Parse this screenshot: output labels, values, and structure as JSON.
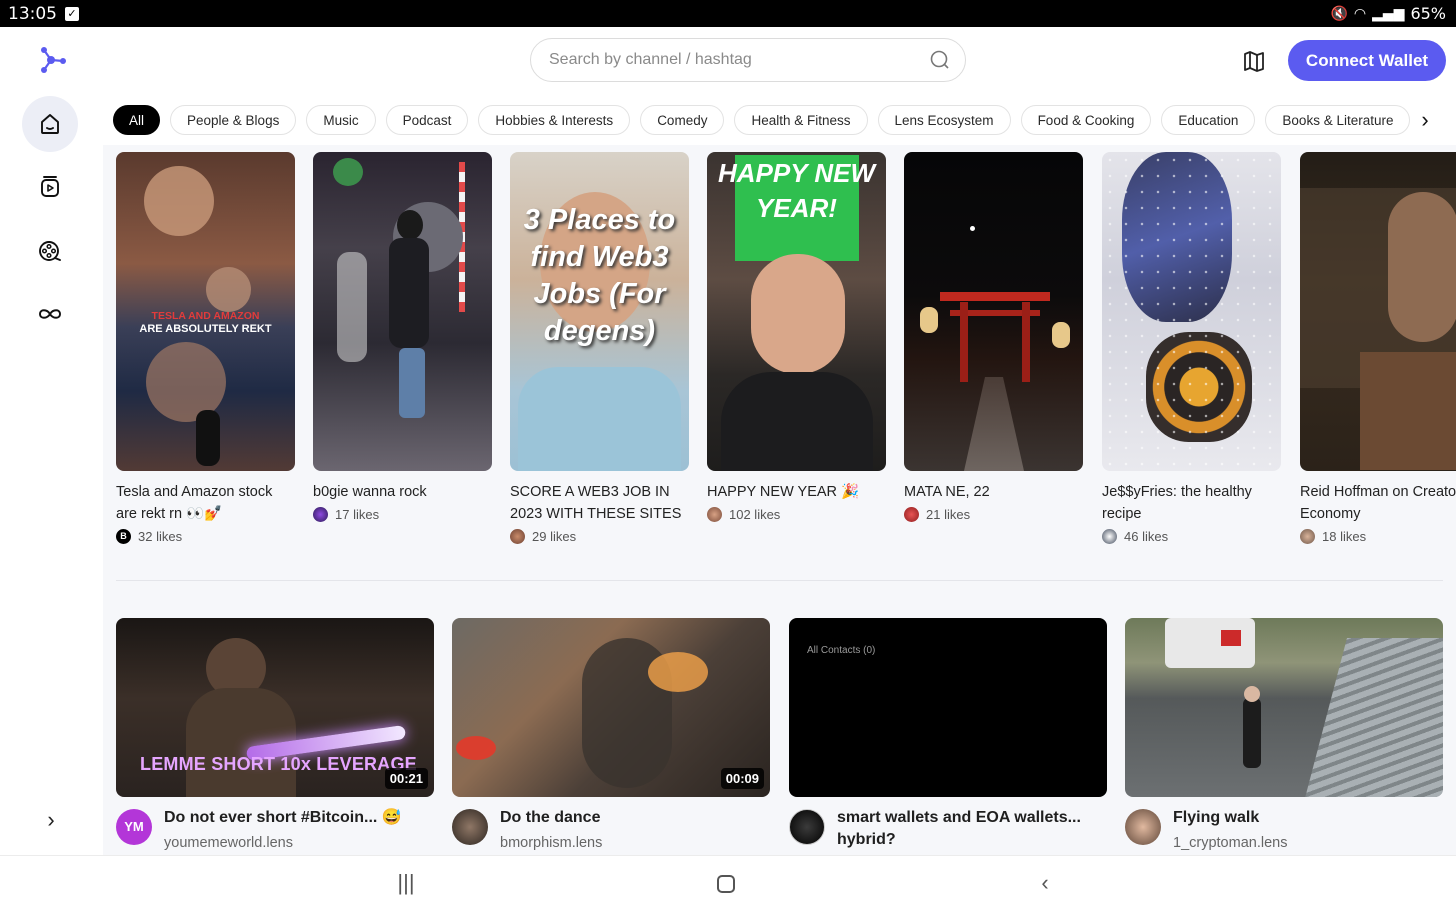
{
  "status_bar": {
    "time": "13:05",
    "battery": "65%"
  },
  "header": {
    "search_placeholder": "Search by channel / hashtag",
    "connect_label": "Connect Wallet",
    "accent_color": "#5b5bf0"
  },
  "categories": [
    "All",
    "People & Blogs",
    "Music",
    "Podcast",
    "Hobbies & Interests",
    "Comedy",
    "Health & Fitness",
    "Lens Ecosystem",
    "Food & Cooking",
    "Education",
    "Books & Literature"
  ],
  "shorts": [
    {
      "title": "Tesla and Amazon stock are rekt rn 👀💅",
      "likes": "32 likes",
      "overlay_line1": "TESLA AND AMAZON",
      "overlay_line2": "ARE ABSOLUTELY REKT"
    },
    {
      "title": "b0gie wanna rock",
      "likes": "17 likes"
    },
    {
      "title": "SCORE A WEB3 JOB IN 2023 WITH THESE SITES",
      "likes": "29 likes",
      "overlay": "3 Places to find Web3 Jobs (For degens)"
    },
    {
      "title": "HAPPY NEW YEAR 🎉",
      "likes": "102 likes",
      "overlay": "HAPPY NEW YEAR!"
    },
    {
      "title": "MATA NE, 22",
      "likes": "21 likes"
    },
    {
      "title": "Je$$yFries: the healthy recipe",
      "likes": "46 likes"
    },
    {
      "title": "Reid Hoffman on Creator Economy",
      "likes": "18 likes"
    }
  ],
  "videos": [
    {
      "title": "Do not ever short #Bitcoin... 😅",
      "channel": "youmemeworld.lens",
      "duration": "00:21",
      "overlay": "LEMME SHORT 10x LEVERAGE",
      "avatar_text": "YM"
    },
    {
      "title": "Do the dance",
      "channel": "bmorphism.lens",
      "duration": "00:09"
    },
    {
      "title": "smart wallets and EOA wallets... hybrid?",
      "channel": "",
      "overlay": "All Contacts (0)"
    },
    {
      "title": "Flying walk",
      "channel": "1_cryptoman.lens"
    }
  ]
}
